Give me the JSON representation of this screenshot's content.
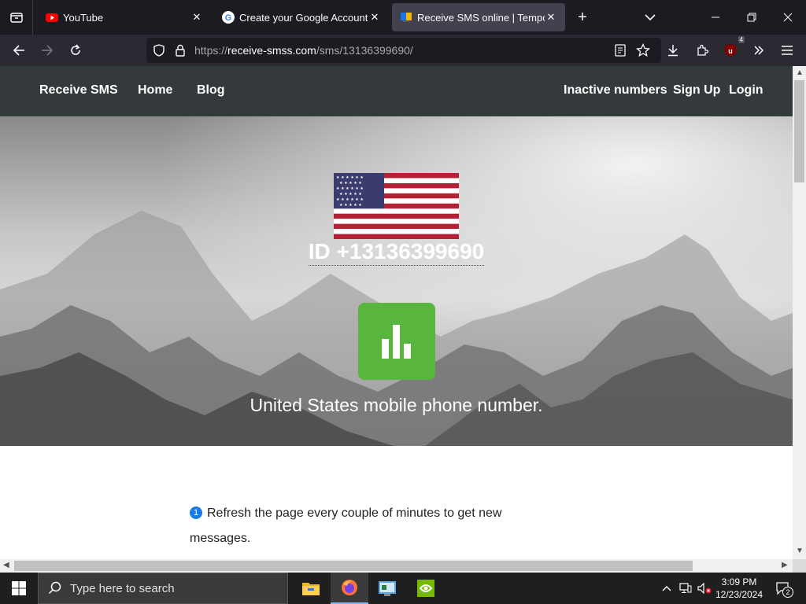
{
  "browser": {
    "tabs": [
      {
        "title": "YouTube",
        "icon": "youtube-icon"
      },
      {
        "title": "Create your Google Account",
        "icon": "google-icon"
      },
      {
        "title": "Receive SMS online | Temporary",
        "icon": "receive-smss-icon",
        "active": true
      }
    ],
    "url": {
      "prefix": "https://",
      "host": "receive-smss.com",
      "path": "/sms/13136399690/"
    },
    "extension_badge": "4"
  },
  "site": {
    "brand": "Receive SMS",
    "nav_left": [
      "Home",
      "Blog"
    ],
    "nav_right": [
      "Inactive numbers",
      "Sign Up",
      "Login"
    ],
    "hero": {
      "id_label": "ID +13136399690",
      "subtitle": "United States mobile phone number."
    },
    "content": {
      "step1_number": "1",
      "step1_text": "Refresh the page every couple of minutes to get new messages."
    },
    "colors": {
      "stats_button": "#58b63f",
      "nav_bg": "#343a3c"
    }
  },
  "taskbar": {
    "search_placeholder": "Type here to search",
    "time": "3:09 PM",
    "date": "12/23/2024",
    "notification_count": "2"
  }
}
